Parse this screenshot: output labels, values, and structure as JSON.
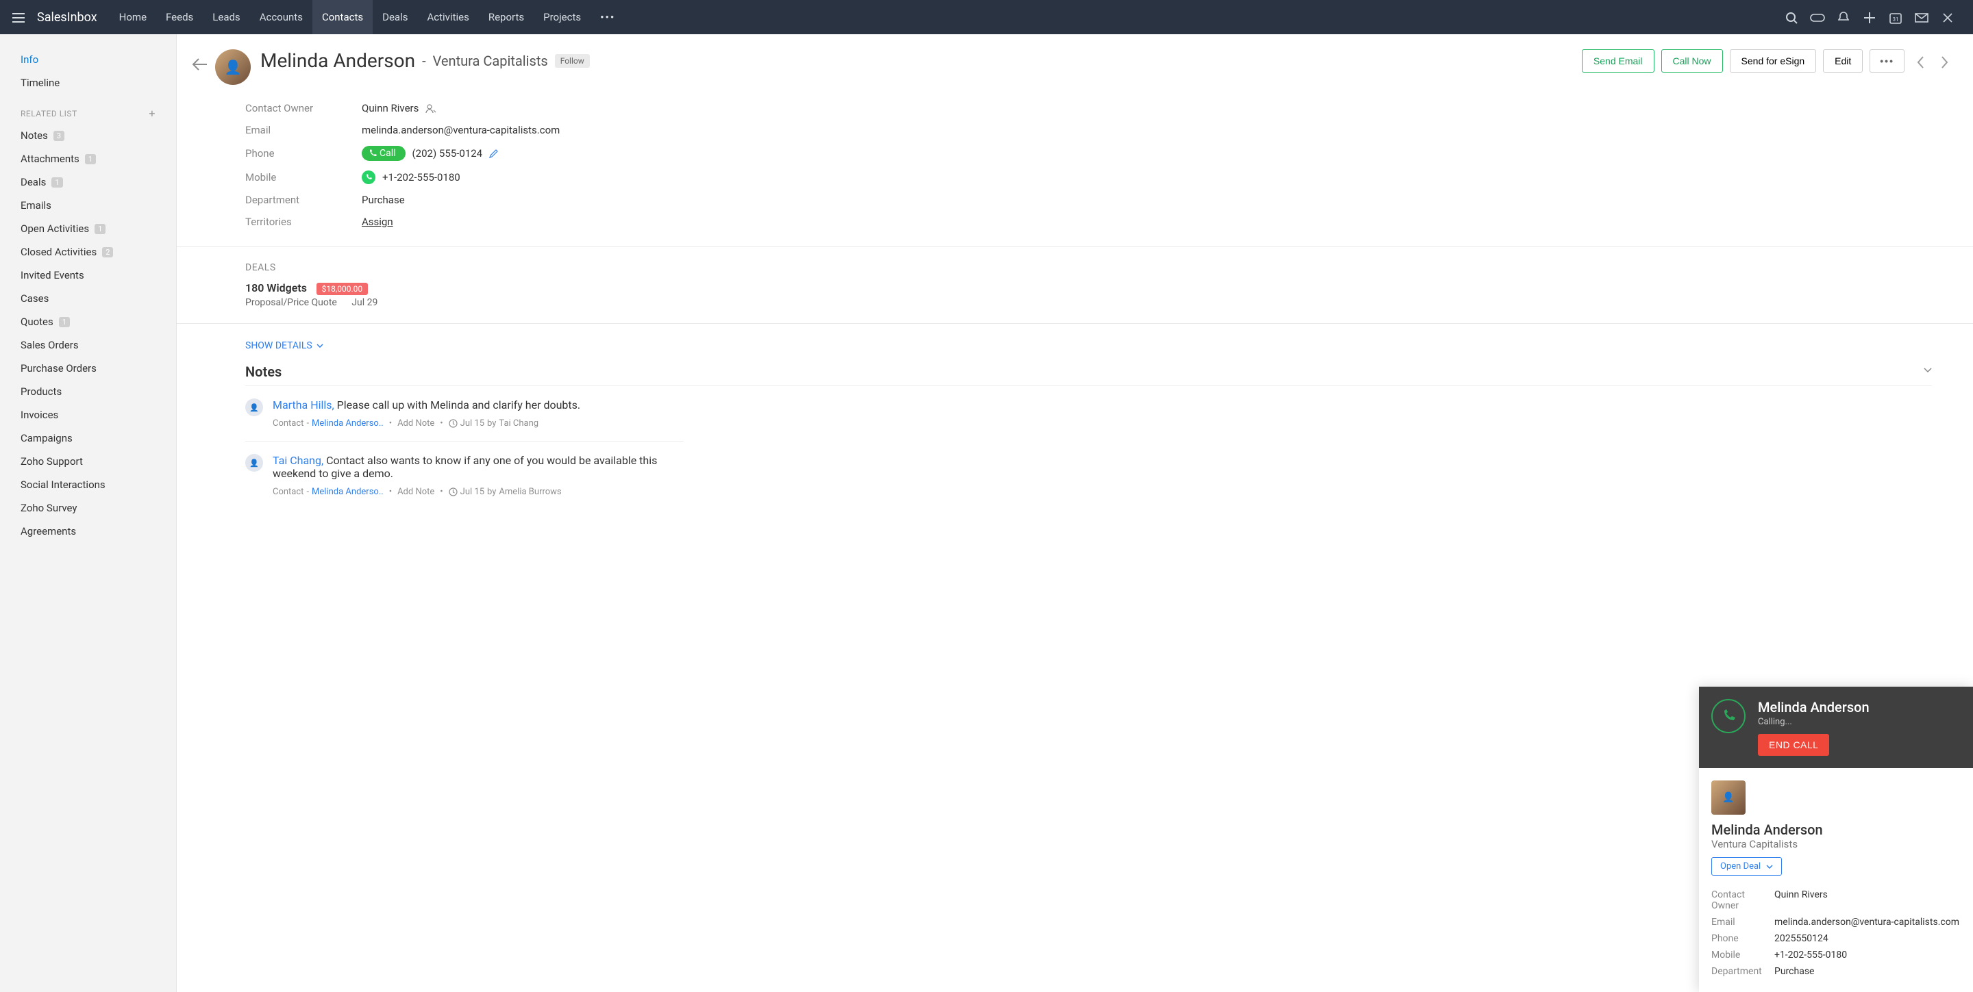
{
  "brand": "SalesInbox",
  "nav": {
    "items": [
      "Home",
      "Feeds",
      "Leads",
      "Accounts",
      "Contacts",
      "Deals",
      "Activities",
      "Reports",
      "Projects"
    ],
    "active": "Contacts"
  },
  "sidebar": {
    "primary": [
      {
        "label": "Info",
        "active": true
      },
      {
        "label": "Timeline"
      }
    ],
    "related_heading": "RELATED LIST",
    "related": [
      {
        "label": "Notes",
        "badge": "3"
      },
      {
        "label": "Attachments",
        "badge": "1"
      },
      {
        "label": "Deals",
        "badge": "1"
      },
      {
        "label": "Emails"
      },
      {
        "label": "Open Activities",
        "badge": "1"
      },
      {
        "label": "Closed Activities",
        "badge": "2"
      },
      {
        "label": "Invited Events"
      },
      {
        "label": "Cases"
      },
      {
        "label": "Quotes",
        "badge": "1"
      },
      {
        "label": "Sales Orders"
      },
      {
        "label": "Purchase Orders"
      },
      {
        "label": "Products"
      },
      {
        "label": "Invoices"
      },
      {
        "label": "Campaigns"
      },
      {
        "label": "Zoho Support"
      },
      {
        "label": "Social Interactions"
      },
      {
        "label": "Zoho Survey"
      },
      {
        "label": "Agreements"
      }
    ]
  },
  "header": {
    "name": "Melinda Anderson",
    "dash": "-",
    "company": "Ventura Capitalists",
    "follow_label": "Follow",
    "actions": {
      "send_email": "Send Email",
      "call_now": "Call Now",
      "send_esign": "Send for eSign",
      "edit": "Edit"
    }
  },
  "fields": {
    "owner_label": "Contact Owner",
    "owner_value": "Quinn Rivers",
    "email_label": "Email",
    "email_value": "melinda.anderson@ventura-capitalists.com",
    "phone_label": "Phone",
    "call_pill": "Call",
    "phone_value": "(202) 555-0124",
    "mobile_label": "Mobile",
    "mobile_value": "+1-202-555-0180",
    "dept_label": "Department",
    "dept_value": "Purchase",
    "terr_label": "Territories",
    "terr_value": "Assign"
  },
  "deals": {
    "heading": "DEALS",
    "name": "180 Widgets",
    "amount": "$18,000.00",
    "stage": "Proposal/Price Quote",
    "date": "Jul 29"
  },
  "show_details": "SHOW DETAILS",
  "notes_heading": "Notes",
  "notes": [
    {
      "author": "Martha Hills,",
      "text": "Please call up with Melinda and clarify her doubts.",
      "rel_label": "Contact",
      "rel_dash": "-",
      "rel_value": "Melinda Anderso..",
      "add_note": "Add Note",
      "date": "Jul 15",
      "by": "by",
      "byname": "Tai Chang"
    },
    {
      "author": "Tai Chang,",
      "text": "Contact also wants to know if any one of you would be available this weekend to give a demo.",
      "rel_label": "Contact",
      "rel_dash": "-",
      "rel_value": "Melinda Anderso..",
      "add_note": "Add Note",
      "date": "Jul 15",
      "by": "by",
      "byname": "Amelia Burrows"
    }
  ],
  "call_panel": {
    "name": "Melinda Anderson",
    "status": "Calling...",
    "end_call": "END CALL",
    "contact_name": "Melinda Anderson",
    "company": "Ventura Capitalists",
    "open_deal": "Open Deal",
    "labels": {
      "owner": "Contact Owner",
      "email": "Email",
      "phone": "Phone",
      "mobile": "Mobile",
      "dept": "Department"
    },
    "values": {
      "owner": "Quinn Rivers",
      "email": "melinda.anderson@ventura-capitalists.com",
      "phone": "2025550124",
      "mobile": "+1-202-555-0180",
      "dept": "Purchase"
    }
  }
}
